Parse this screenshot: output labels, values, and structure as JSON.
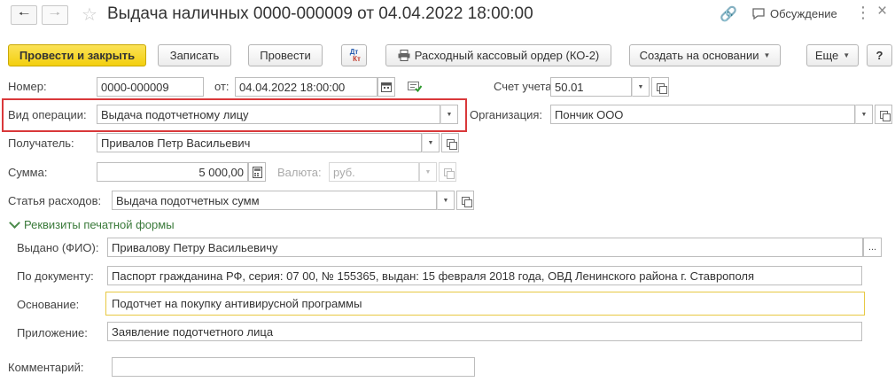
{
  "window": {
    "title": "Выдача наличных 0000-000009 от 04.04.2022 18:00:00",
    "discussion_label": "Обсуждение"
  },
  "toolbar": {
    "post_close": "Провести и закрыть",
    "save": "Записать",
    "post": "Провести",
    "dt_kt_top": "Дт",
    "dt_kt_bottom": "Кт",
    "print_ko2": "Расходный кассовый ордер (КО-2)",
    "create_based": "Создать на основании",
    "more": "Еще",
    "help": "?"
  },
  "form": {
    "number_label": "Номер:",
    "number_value": "0000-000009",
    "from_label": "от:",
    "date_value": "04.04.2022 18:00:00",
    "account_label": "Счет учета:",
    "account_value": "50.01",
    "operation_label": "Вид операции:",
    "operation_value": "Выдача подотчетному лицу",
    "organization_label": "Организация:",
    "organization_value": "Пончик ООО",
    "recipient_label": "Получатель:",
    "recipient_value": "Привалов Петр Васильевич",
    "amount_label": "Сумма:",
    "amount_value": "5 000,00",
    "currency_label": "Валюта:",
    "currency_value": "руб.",
    "expense_label": "Статья расходов:",
    "expense_value": "Выдача подотчетных сумм",
    "print_group_label": "Реквизиты печатной формы",
    "issued_label": "Выдано (ФИО):",
    "issued_value": "Привалову Петру Васильевичу",
    "document_label": "По документу:",
    "document_value": "Паспорт гражданина РФ, серия: 07 00, № 155365, выдан: 15 февраля 2018 года, ОВД Ленинского района г. Ставрополя",
    "basis_label": "Основание:",
    "basis_value": "Подотчет на покупку антивирусной программы",
    "attachment_label": "Приложение:",
    "attachment_value": "Заявление подотчетного лица",
    "comment_label": "Комментарий:",
    "comment_value": "",
    "ellipsis": "..."
  },
  "colors": {
    "primary_button": "#f3cf0e",
    "highlight_border": "#d9383a",
    "group_text": "#3a7a3a",
    "active_field_border": "#e7c842"
  }
}
